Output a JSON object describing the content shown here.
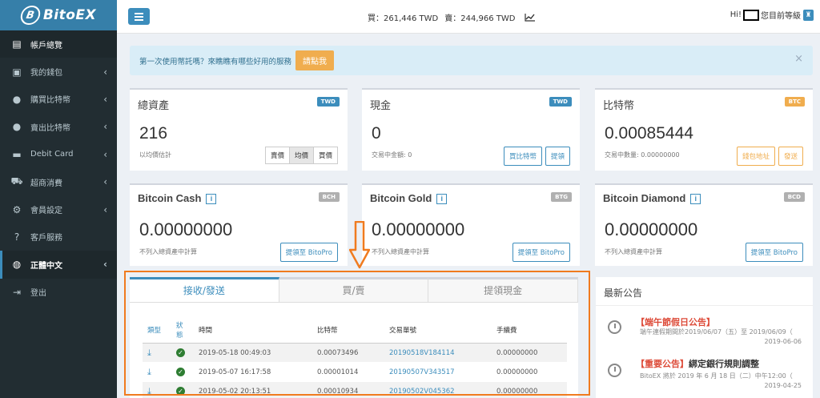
{
  "brand": {
    "name": "BitoEX"
  },
  "sidebar": {
    "items": [
      {
        "label": "帳戶總覽",
        "icon": "dashboard-icon"
      },
      {
        "label": "我的錢包",
        "icon": "wallet-icon"
      },
      {
        "label": "購買比特幣",
        "icon": "download-circle-icon"
      },
      {
        "label": "賣出比特幣",
        "icon": "upload-circle-icon"
      },
      {
        "label": "Debit Card",
        "icon": "card-icon"
      },
      {
        "label": "超商消費",
        "icon": "cart-icon"
      },
      {
        "label": "會員設定",
        "icon": "gears-icon"
      },
      {
        "label": "客戶服務",
        "icon": "question-icon"
      },
      {
        "label": "正體中文",
        "icon": "globe-icon"
      },
      {
        "label": "登出",
        "icon": "logout-icon"
      }
    ]
  },
  "header": {
    "buy_label": "買：",
    "buy_price": "261,446 TWD",
    "sell_label": "賣：",
    "sell_price": "244,966 TWD",
    "greeting": "Hi!",
    "level_text": "您目前等級"
  },
  "callout": {
    "text": "第一次使用幣託嗎？來瞧瞧有哪些好用的服務",
    "button": "請點我",
    "close": "×"
  },
  "cards": {
    "total": {
      "title": "總資產",
      "badge": "TWD",
      "value": "216",
      "sub": "以均價估計",
      "btns": [
        "賣價",
        "均價",
        "買價"
      ]
    },
    "cash": {
      "title": "現金",
      "badge": "TWD",
      "value": "0",
      "sub": "交易中金額: 0",
      "btns": [
        "買比特幣",
        "提領"
      ]
    },
    "btc": {
      "title": "比特幣",
      "badge": "BTC",
      "value": "0.00085444",
      "sub": "交易中數量: 0.00000000",
      "btns": [
        "錢包地址",
        "發送"
      ]
    },
    "bch": {
      "title": "Bitcoin Cash",
      "badge": "BCH",
      "value": "0.00000000",
      "sub": "不列入總資產中計算",
      "btn": "提領至 BitoPro"
    },
    "btg": {
      "title": "Bitcoin Gold",
      "badge": "BTG",
      "value": "0.00000000",
      "sub": "不列入總資產中計算",
      "btn": "提領至 BitoPro"
    },
    "bcd": {
      "title": "Bitcoin Diamond",
      "badge": "BCD",
      "value": "0.00000000",
      "sub": "不列入總資產中計算",
      "btn": "提領至 BitoPro"
    }
  },
  "transactions": {
    "tabs": [
      "接收/發送",
      "買/賣",
      "提領現金"
    ],
    "columns": [
      "類型",
      "狀態",
      "時間",
      "比特幣",
      "交易單號",
      "手續費"
    ],
    "rows": [
      {
        "time": "2019-05-18 00:49:03",
        "btc": "0.00073496",
        "order": "20190518V184114",
        "fee": "0.00000000"
      },
      {
        "time": "2019-05-07 16:17:58",
        "btc": "0.00001014",
        "order": "20190507V343517",
        "fee": "0.00000000"
      },
      {
        "time": "2019-05-02 20:13:51",
        "btc": "0.00010934",
        "order": "20190502V045362",
        "fee": "0.00000000"
      }
    ]
  },
  "announcements": {
    "title": "最新公告",
    "items": [
      {
        "tag": "【端午節假日公告】",
        "title": "",
        "desc": "端午連假期間於2019/06/07（五）至 2019/06/09（",
        "date": "2019-06-06"
      },
      {
        "tag": "【重要公告】",
        "title": "綁定銀行規則調整",
        "desc": "BitoEX 將於 2019 年 6 月 18 日（二）中午12:00（",
        "date": "2019-04-25"
      }
    ]
  },
  "colors": {
    "accent": "#3c8dbc",
    "sidebar": "#222d32",
    "highlight": "#f07b1f"
  }
}
